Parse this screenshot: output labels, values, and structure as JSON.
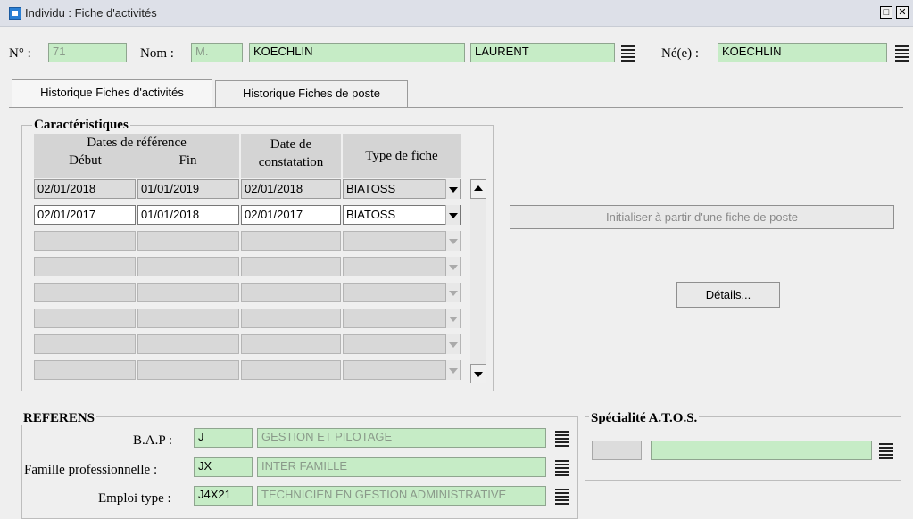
{
  "window": {
    "title": "Individu : Fiche d'activités",
    "restore_glyph": "□",
    "close_glyph": "✕"
  },
  "header": {
    "num_label": "N° :",
    "num_value": "71",
    "nom_label": "Nom :",
    "civilite": "M.",
    "nom": "KOECHLIN",
    "prenom": "LAURENT",
    "nee_label": "Né(e) :",
    "nom_naissance": "KOECHLIN"
  },
  "tabs": [
    {
      "label": "Historique Fiches d'activités",
      "active": true
    },
    {
      "label": "Historique Fiches de poste",
      "active": false
    }
  ],
  "caracteristiques": {
    "title": "Caractéristiques",
    "headers": {
      "dates_ref": "Dates de référence",
      "debut": "Début",
      "fin": "Fin",
      "date_constat_1": "Date de",
      "date_constat_2": "constatation",
      "type": "Type de fiche"
    },
    "rows": [
      {
        "debut": "02/01/2018",
        "fin": "01/01/2019",
        "constat": "02/01/2018",
        "type": "BIATOSS",
        "style": "grey"
      },
      {
        "debut": "02/01/2017",
        "fin": "01/01/2018",
        "constat": "02/01/2017",
        "type": "BIATOSS",
        "style": "white"
      },
      {
        "debut": "",
        "fin": "",
        "constat": "",
        "type": "",
        "style": "empty"
      },
      {
        "debut": "",
        "fin": "",
        "constat": "",
        "type": "",
        "style": "empty"
      },
      {
        "debut": "",
        "fin": "",
        "constat": "",
        "type": "",
        "style": "empty"
      },
      {
        "debut": "",
        "fin": "",
        "constat": "",
        "type": "",
        "style": "empty"
      },
      {
        "debut": "",
        "fin": "",
        "constat": "",
        "type": "",
        "style": "empty"
      },
      {
        "debut": "",
        "fin": "",
        "constat": "",
        "type": "",
        "style": "empty"
      }
    ]
  },
  "buttons": {
    "initialiser": "Initialiser à partir d'une fiche de poste",
    "details": "Détails..."
  },
  "referens": {
    "title": "REFERENS",
    "bap_label": "B.A.P :",
    "bap_code": "J",
    "bap_value": "GESTION ET PILOTAGE",
    "famille_label": "Famille professionnelle :",
    "famille_code": "JX",
    "famille_value": "INTER FAMILLE",
    "emploi_label": "Emploi type :",
    "emploi_code": "J4X21",
    "emploi_value": "TECHNICIEN EN GESTION ADMINISTRATIVE"
  },
  "specialite": {
    "title": "Spécialité A.T.O.S.",
    "code": "",
    "value": ""
  }
}
